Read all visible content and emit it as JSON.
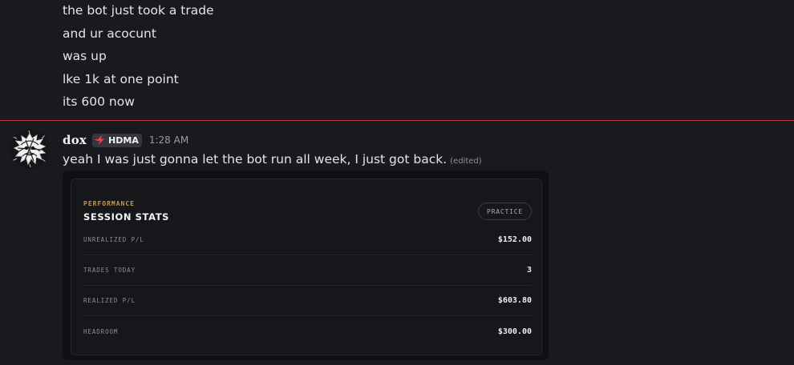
{
  "previous_messages": [
    "the bot just took a trade",
    "and ur acocunt",
    "was up",
    "lke 1k at one point",
    "its 600 now"
  ],
  "message": {
    "username": "dox",
    "tag": "HDMA",
    "timestamp": "1:28 AM",
    "text": "yeah I was just gonna let the bot run all week, I just got back.",
    "edited_label": "(edited)"
  },
  "embed": {
    "section_label": "PERFORMANCE",
    "title": "SESSION STATS",
    "badge": "PRACTICE",
    "stats": [
      {
        "label": "UNREALIZED P/L",
        "value": "$152.00"
      },
      {
        "label": "TRADES TODAY",
        "value": "3"
      },
      {
        "label": "REALIZED P/L",
        "value": "$603.80"
      },
      {
        "label": "HEADROOM",
        "value": "$300.00"
      }
    ]
  },
  "colors": {
    "background": "#1a1a1e",
    "new_message_divider": "#b33a3f",
    "section_label": "#c69a46",
    "tag_icon": "#ed4245"
  },
  "icons": {
    "tag": "lightning-bolt-icon",
    "avatar": "scribble-avatar"
  }
}
